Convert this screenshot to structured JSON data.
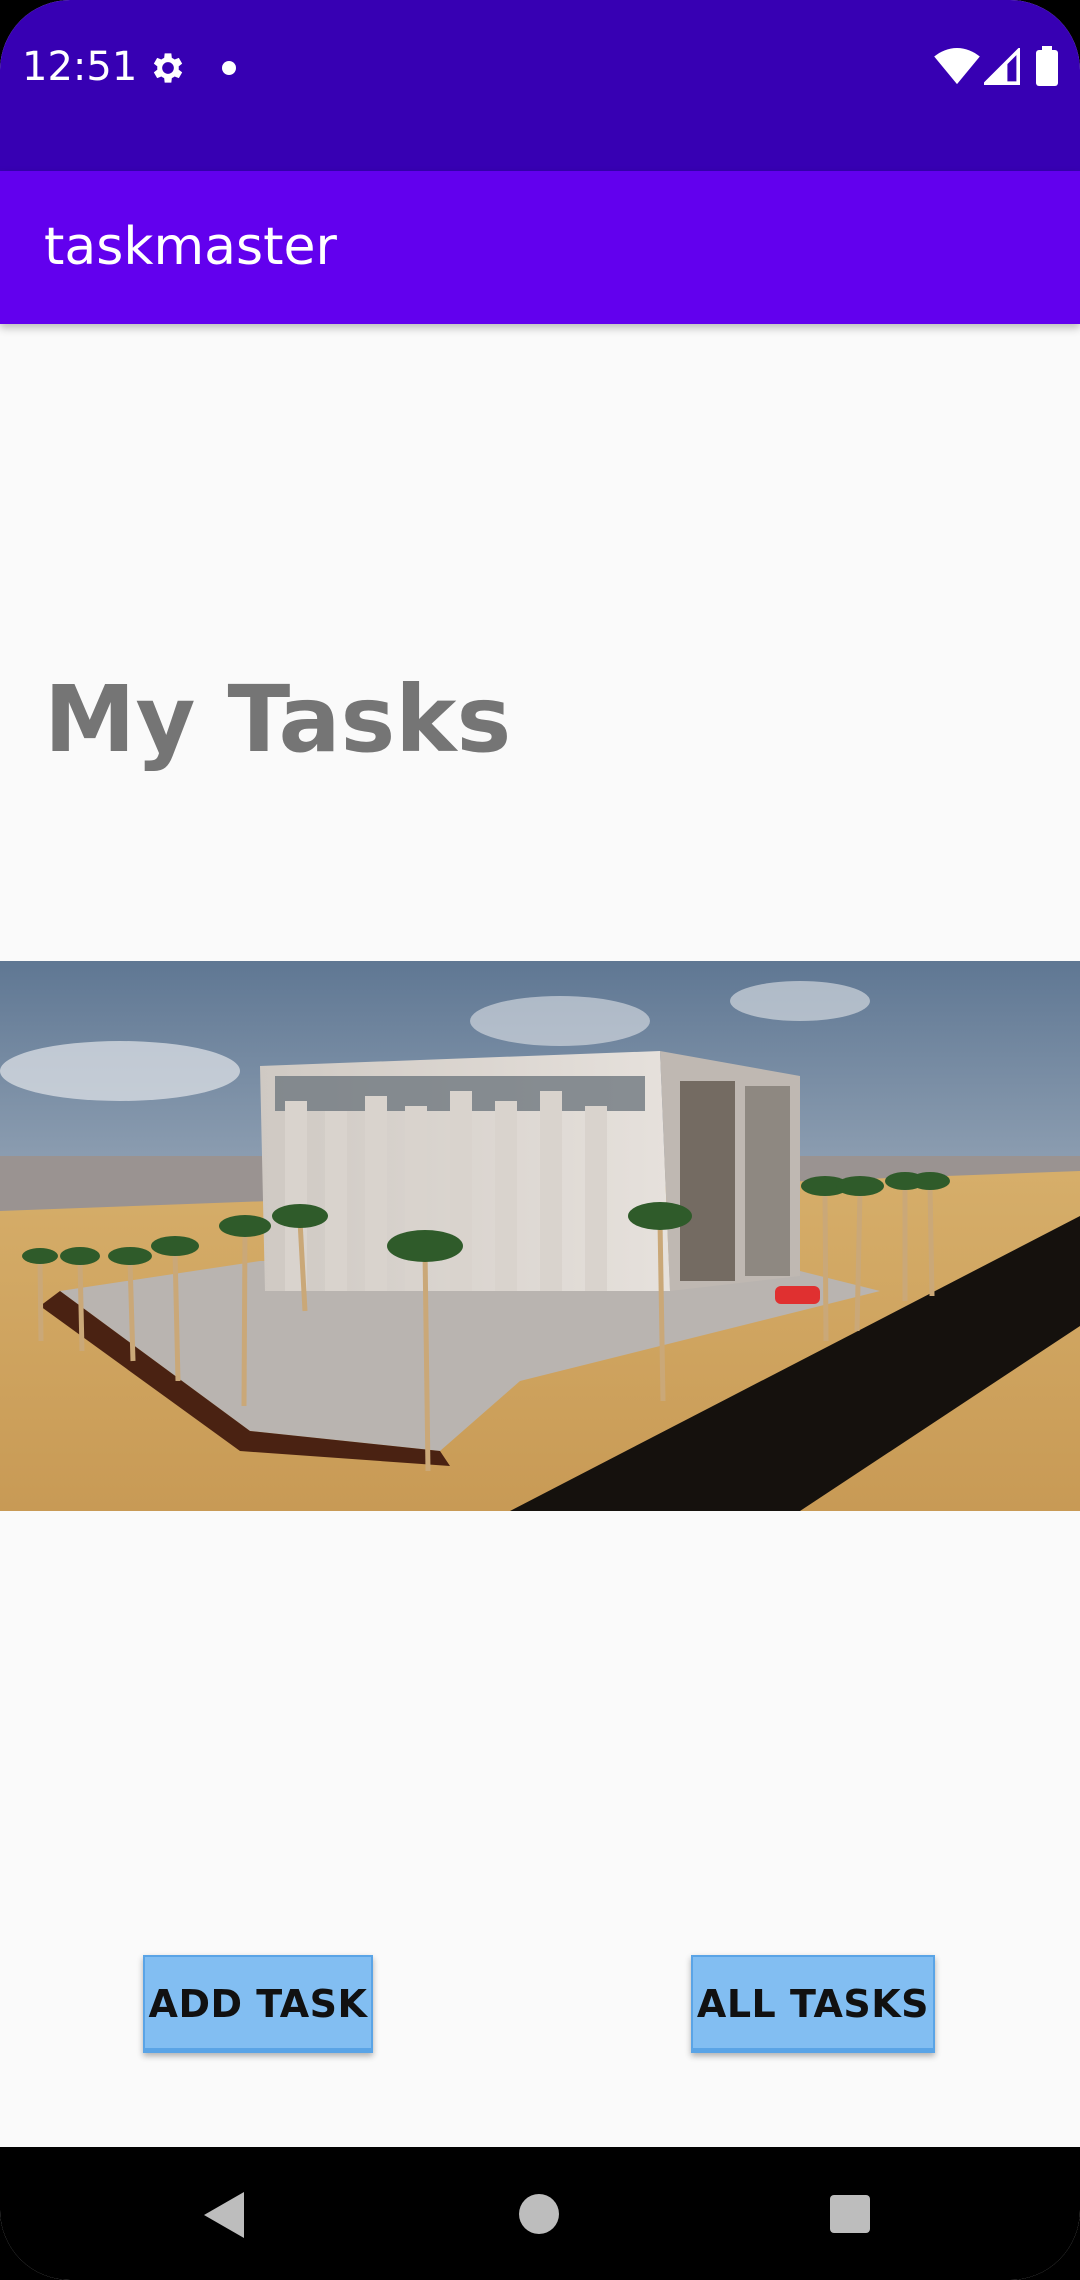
{
  "status_bar": {
    "time": "12:51",
    "icons": [
      "gear-icon",
      "notification-dot-icon",
      "wifi-icon",
      "signal-icon",
      "battery-icon"
    ]
  },
  "app_bar": {
    "title": "taskmaster"
  },
  "main": {
    "heading": "My Tasks",
    "image": "modern-building-render"
  },
  "buttons": {
    "add_task": "ADD TASK",
    "all_tasks": "ALL TASKS"
  },
  "nav_bar": {
    "icons": [
      "back-icon",
      "home-icon",
      "recents-icon"
    ]
  },
  "colors": {
    "status_bar": "#3700b3",
    "app_bar": "#6200ee",
    "button": "#82bef2",
    "heading": "#757575"
  }
}
